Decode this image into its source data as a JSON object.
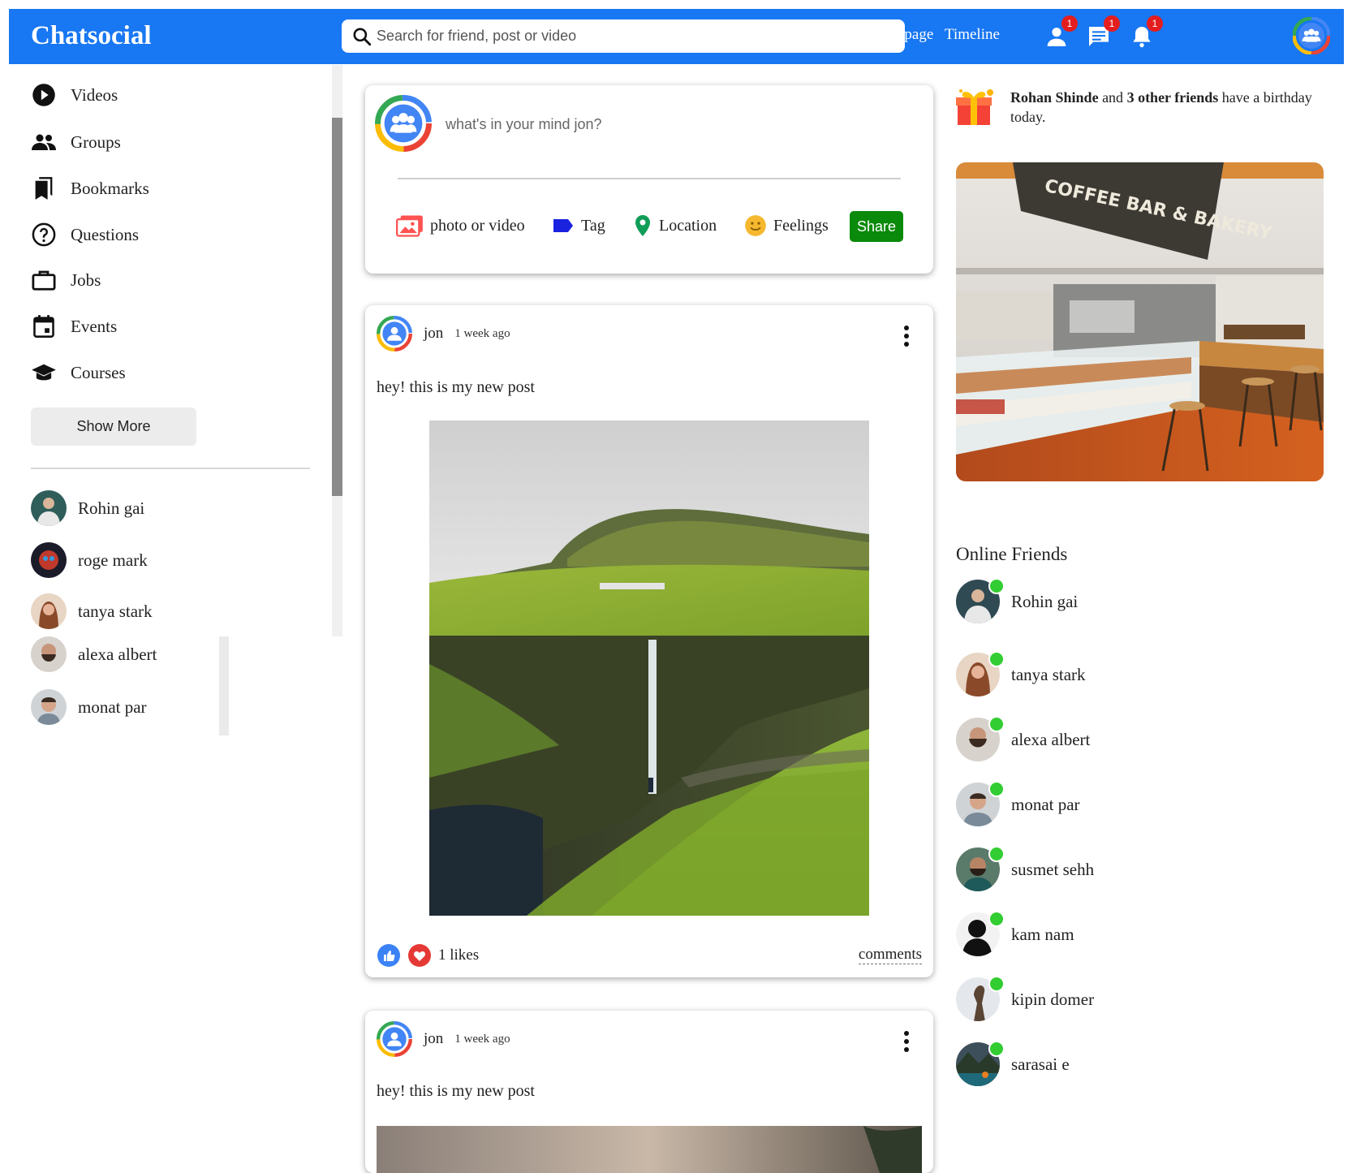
{
  "app": {
    "name": "Chatsocial"
  },
  "search": {
    "placeholder": "Search for friend, post or video"
  },
  "nav": {
    "homepage": "Homepage",
    "timeline": "Timeline"
  },
  "notifications": {
    "friend_requests": "1",
    "messages": "1",
    "alerts": "1"
  },
  "sidebar": {
    "items": [
      {
        "label": "Videos",
        "icon": "play-circle-icon"
      },
      {
        "label": "Groups",
        "icon": "groups-icon"
      },
      {
        "label": "Bookmarks",
        "icon": "bookmarks-icon"
      },
      {
        "label": "Questions",
        "icon": "question-icon"
      },
      {
        "label": "Jobs",
        "icon": "briefcase-icon"
      },
      {
        "label": "Events",
        "icon": "calendar-icon"
      },
      {
        "label": "Courses",
        "icon": "graduation-cap-icon"
      }
    ],
    "show_more": "Show More",
    "friends": [
      "Rohin gai",
      "roge mark",
      "tanya stark",
      "alexa albert",
      "monat par"
    ]
  },
  "share": {
    "placeholder": "what's in your mind jon?",
    "options": [
      "photo or video",
      "Tag",
      "Location",
      "Feelings"
    ],
    "button": "Share"
  },
  "posts": [
    {
      "user": "jon",
      "time": "1 week ago",
      "text": "hey! this is my new post",
      "likes": "1 likes",
      "comments": "comments"
    },
    {
      "user": "jon",
      "time": "1 week ago",
      "text": "hey! this is my new post"
    }
  ],
  "birthday": {
    "name": "Rohan Shinde",
    "connector": "and",
    "others": "3 other friends",
    "rest": "have a birthday today."
  },
  "ad": {
    "sign_text": "COFFEE BAR & BAKERY"
  },
  "online": {
    "title": "Online Friends",
    "friends": [
      "Rohin gai",
      "tanya stark",
      "alexa albert",
      "monat par",
      "susmet sehh",
      "kam nam",
      "kipin domer",
      "sarasai e"
    ]
  },
  "colors": {
    "brand": "#1877f2",
    "share": "#0a8a0a",
    "online": "#32cd32",
    "badge": "#e41e1e"
  }
}
